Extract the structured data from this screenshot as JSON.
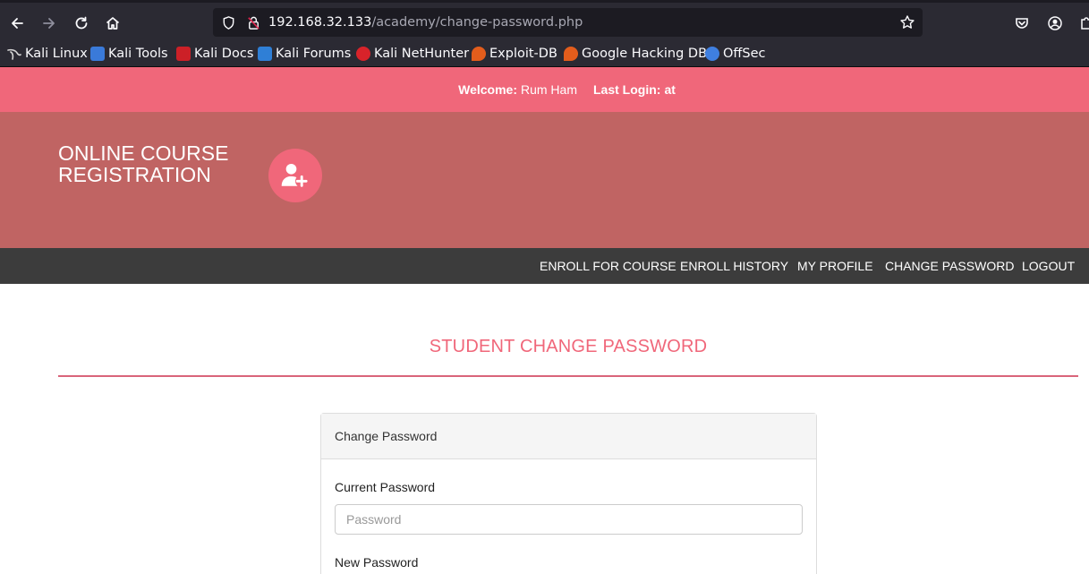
{
  "browser": {
    "url_host": "192.168.32.133",
    "url_path": "/academy/change-password.php",
    "bookmarks": [
      {
        "label": "Kali Linux",
        "icon": "kali-dragon-icon",
        "color": "#3b3b3b"
      },
      {
        "label": "Kali Tools",
        "icon": "kali-tools-icon",
        "color": "#3a7ad9"
      },
      {
        "label": "Kali Docs",
        "icon": "kali-docs-icon",
        "color": "#cc2027"
      },
      {
        "label": "Kali Forums",
        "icon": "kali-forums-icon",
        "color": "#2f7fd6"
      },
      {
        "label": "Kali NetHunter",
        "icon": "nethunter-icon",
        "color": "#d8232a"
      },
      {
        "label": "Exploit-DB",
        "icon": "exploit-db-icon",
        "color": "#e35d1c"
      },
      {
        "label": "Google Hacking DB",
        "icon": "ghdb-icon",
        "color": "#e35d1c"
      },
      {
        "label": "OffSec",
        "icon": "offsec-icon",
        "color": "#3f7fe0"
      }
    ]
  },
  "welcome": {
    "label": "Welcome:",
    "user_name": "Rum Ham",
    "last_login_label": "Last Login:",
    "last_login_value": "at"
  },
  "site": {
    "title": "ONLINE COURSE REGISTRATION",
    "logo_icon": "user-plus-icon"
  },
  "nav": {
    "items": [
      {
        "label": "ENROLL FOR COURSE"
      },
      {
        "label": "ENROLL HISTORY"
      },
      {
        "label": "MY PROFILE"
      },
      {
        "label": "CHANGE PASSWORD"
      },
      {
        "label": "LOGOUT"
      }
    ]
  },
  "page": {
    "heading": "STUDENT CHANGE PASSWORD"
  },
  "form": {
    "panel_title": "Change Password",
    "current_password_label": "Current Password",
    "current_password_placeholder": "Password",
    "new_password_label": "New Password"
  },
  "colors": {
    "welcome_bar": "#f0677a",
    "header_band": "#c06463",
    "nav_bar": "#3c3c3c",
    "accent": "#f0677a"
  }
}
